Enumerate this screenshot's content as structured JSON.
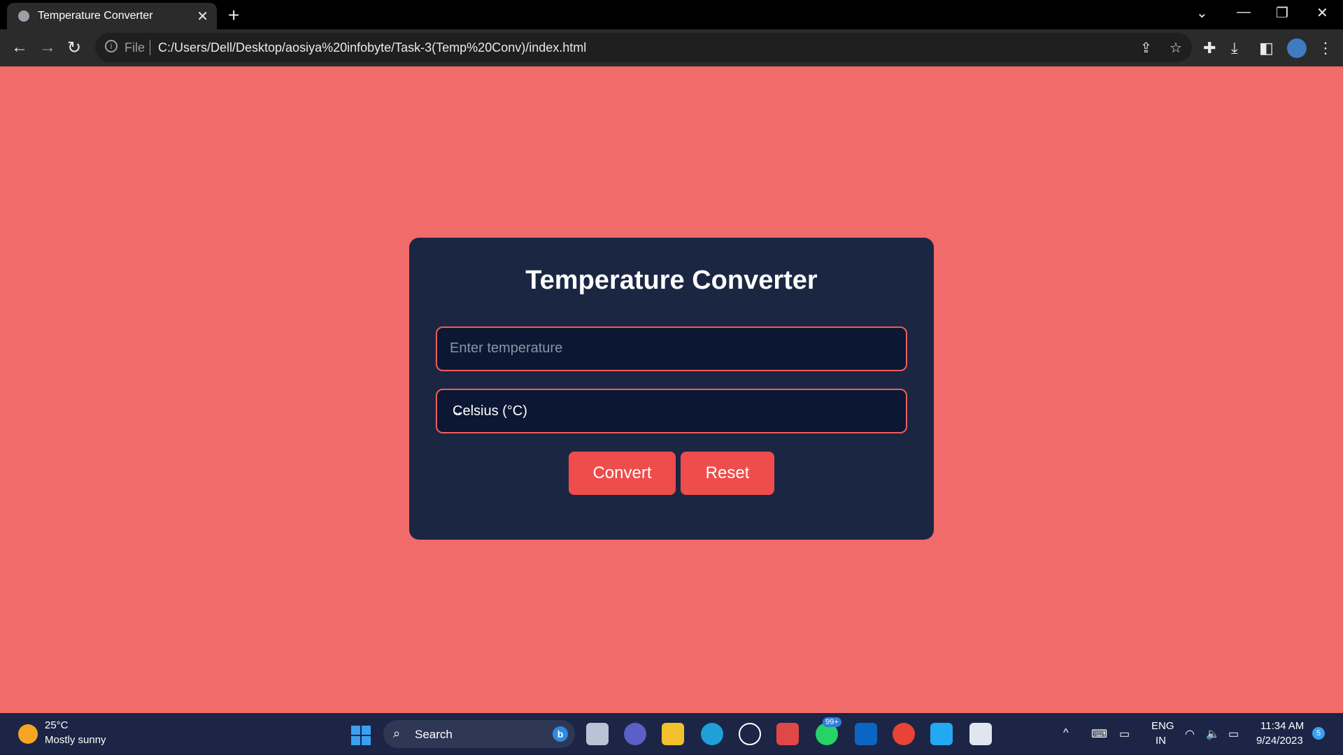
{
  "browser": {
    "tab_title": "Temperature Converter",
    "address_prefix": "File",
    "url": "C:/Users/Dell/Desktop/aosiya%20infobyte/Task-3(Temp%20Conv)/index.html"
  },
  "converter": {
    "title": "Temperature Converter",
    "input_placeholder": "Enter temperature",
    "unit_selected": "Celsius (°C)",
    "convert_label": "Convert",
    "reset_label": "Reset"
  },
  "taskbar": {
    "weather_temp": "25°C",
    "weather_desc": "Mostly sunny",
    "search_label": "Search",
    "whatsapp_badge": "99+",
    "lang_line1": "ENG",
    "lang_line2": "IN",
    "time": "11:34 AM",
    "date": "9/24/2023",
    "notification_count": "5"
  },
  "colors": {
    "page_bg": "#f26b6b",
    "card_bg": "#1b2742",
    "accent": "#ef4c4c"
  }
}
